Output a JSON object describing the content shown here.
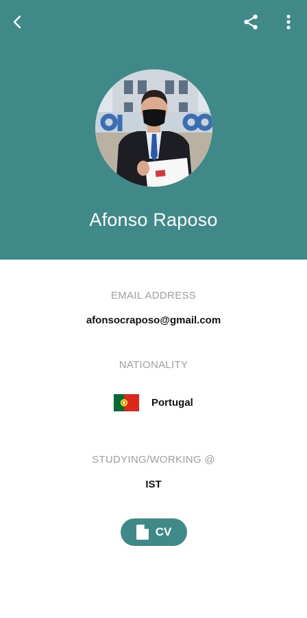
{
  "colors": {
    "header_bg": "#3f8a89",
    "label_gray": "#9e9e9e",
    "accent": "#3f8a89"
  },
  "header": {
    "back_icon": "chevron-left-icon",
    "share_icon": "share-icon",
    "more_icon": "more-vert-icon"
  },
  "profile": {
    "name": "Afonso Raposo",
    "avatar": "profile-photo"
  },
  "details": {
    "email_label": "EMAIL ADDRESS",
    "email_value": "afonsocraposo@gmail.com",
    "nationality_label": "NATIONALITY",
    "nationality_value": "Portugal",
    "nationality_flag": "portugal-flag",
    "work_label": "STUDYING/WORKING @",
    "work_value": "IST"
  },
  "cv_button": {
    "label": "CV",
    "icon": "document-icon"
  }
}
